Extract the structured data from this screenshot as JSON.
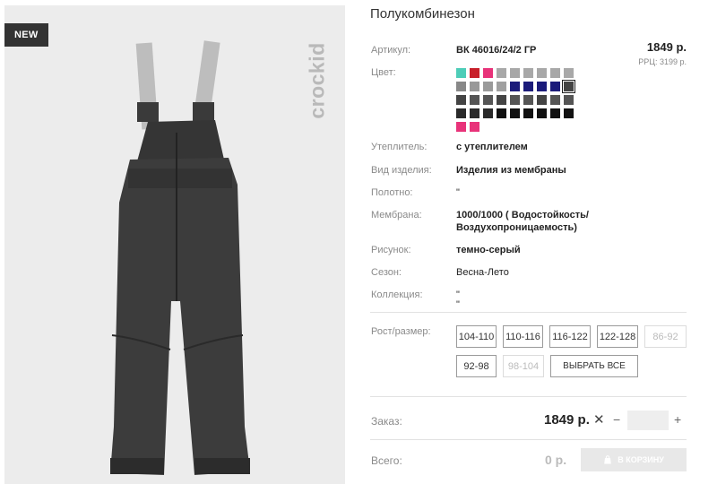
{
  "badge": "NEW",
  "brand": "crockid",
  "product": {
    "title": "Полукомбинезон",
    "price": "1849 р.",
    "rrp": "РРЦ: 3199 р."
  },
  "specs": {
    "article_label": "Артикул:",
    "article_value": "ВК 46016/24/2 ГР",
    "color_label": "Цвет:",
    "insulation_label": "Утеплитель:",
    "insulation_value": "с утеплителем",
    "type_label": "Вид изделия:",
    "type_value": "Изделия из мембраны",
    "fabric_label": "Полотно:",
    "fabric_value": "\"",
    "membrane_label": "Мембрана:",
    "membrane_value_1": "1000/1000 ( Водостойкость/",
    "membrane_value_2": "Воздухопроницаемость)",
    "pattern_label": "Рисунок:",
    "pattern_value": "темно-серый",
    "season_label": "Сезон:",
    "season_value": "Весна-Лето",
    "collection_label": "Коллекция:",
    "collection_value_1": "\"",
    "collection_value_2": "\""
  },
  "colors": [
    "#4ecdb8",
    "#c8202a",
    "#e8337a",
    "#a8a8a8",
    "#a8a8a8",
    "#a8a8a8",
    "#a8a8a8",
    "#a8a8a8",
    "#a8a8a8",
    "#888888",
    "#999999",
    "#9a9a9a",
    "#a0a0a0",
    "#1b1b7a",
    "#1b1b7a",
    "#1b1b7a",
    "#1b1b7a",
    "#444444",
    "#444444",
    "#555555",
    "#555555",
    "#444444",
    "#555555",
    "#555555",
    "#444444",
    "#555555",
    "#555555",
    "#2a2a2a",
    "#2a2a2a",
    "#2a2a2a",
    "#111111",
    "#111111",
    "#111111",
    "#111111",
    "#111111",
    "#111111",
    "#e8337a",
    "#e8337a"
  ],
  "size_section": {
    "label": "Рост/размер:",
    "sizes": [
      "104-110",
      "110-116",
      "116-122",
      "122-128",
      "86-92",
      "92-98",
      "98-104"
    ],
    "select_all": "ВЫБРАТЬ ВСЕ"
  },
  "order": {
    "label": "Заказ:",
    "price": "1849 р.",
    "quantity": ""
  },
  "total": {
    "label": "Всего:",
    "value": "0 р.",
    "cart_button": "В КОРЗИНУ"
  }
}
